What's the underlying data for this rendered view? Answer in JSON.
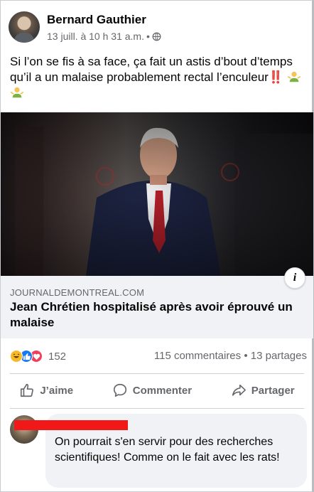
{
  "post": {
    "author": "Bernard Gauthier",
    "timestamp": "13 juill. à 10 h 31 a.m.",
    "separator": "•",
    "privacy_icon": "globe-icon",
    "text": "Si l’on se fis à sa face, ça fait un astis d’bout d’temps qu’il a un malaise probablement rectal l’enculeur",
    "emoji": "‼️"
  },
  "link": {
    "domain": "JOURNALDEMONTREAL.COM",
    "title": "Jean Chrétien hospitalisé après avoir éprouvé un malaise",
    "info_icon_label": "i"
  },
  "stats": {
    "reaction_count": "152",
    "comments": "115 commentaires",
    "dot": "•",
    "shares": "13 partages"
  },
  "actions": {
    "like": "J’aime",
    "comment": "Commenter",
    "share": "Partager"
  },
  "comment": {
    "name_fragment": "...  .. .",
    "text": "On pourrait s'en servir pour des recherches scientifiques! Comme on le fait avec les rats!"
  },
  "colors": {
    "accent": "#1877f2",
    "secondary_text": "#65676b",
    "redaction": "#f01818",
    "link_background": "#f0f2f5"
  }
}
